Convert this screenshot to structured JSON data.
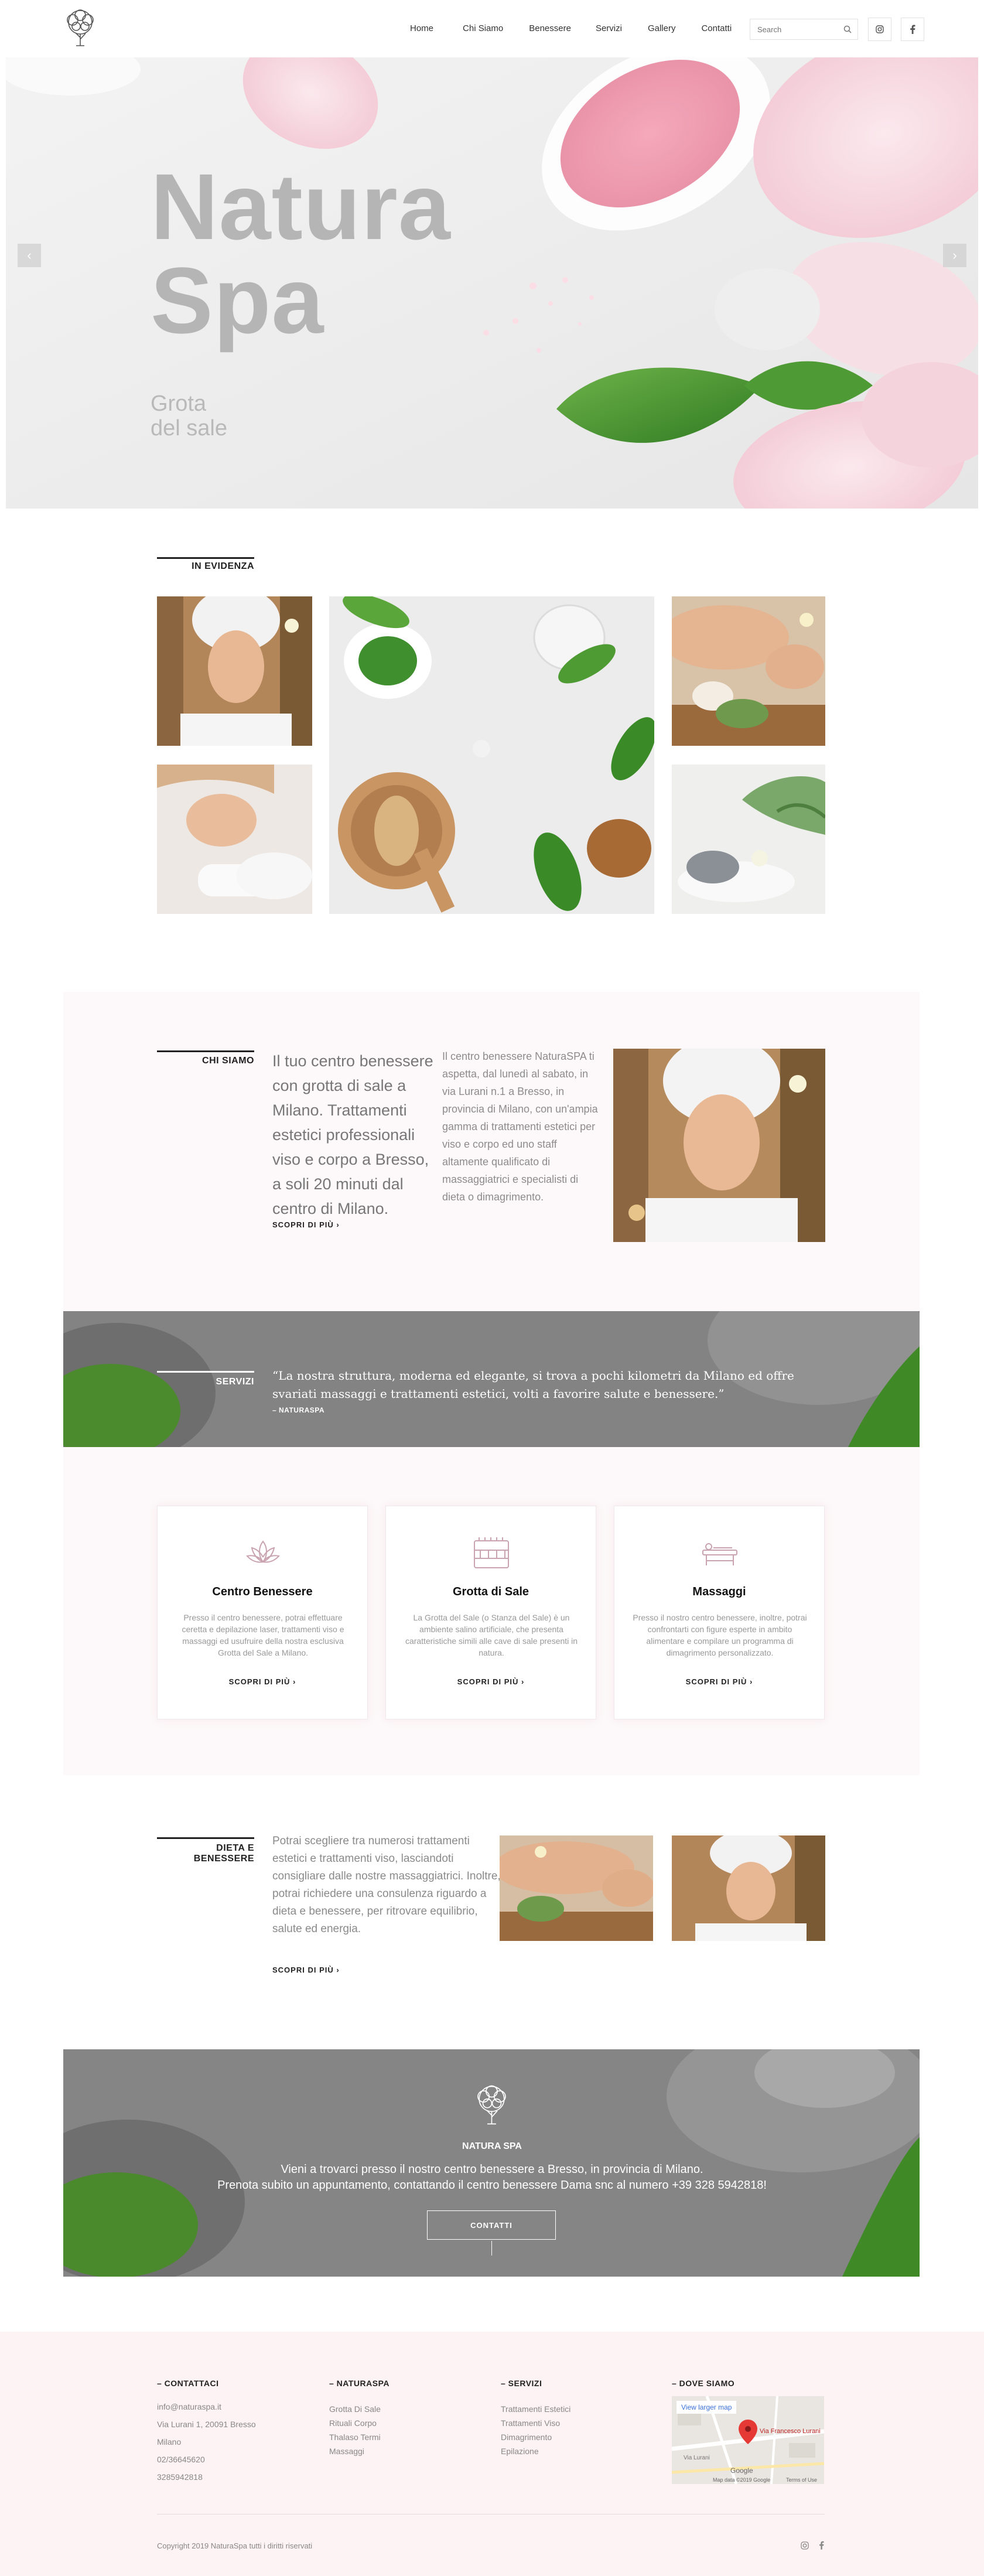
{
  "brand": {
    "name": "NATURA SPA"
  },
  "nav": {
    "items": [
      "Home",
      "Chi Siamo",
      "Benessere",
      "Servizi",
      "Gallery",
      "Contatti"
    ]
  },
  "search": {
    "placeholder": "Search"
  },
  "social": {
    "instagram": "instagram-icon",
    "facebook": "facebook-icon"
  },
  "hero": {
    "title_line1": "Natura",
    "title_line2": "Spa",
    "subtitle_line1": "Grota",
    "subtitle_line2": "del sale"
  },
  "evidenza": {
    "label": "IN EVIDENZA"
  },
  "chi_siamo": {
    "label": "CHI SIAMO",
    "lead": "Il tuo centro benessere con grotta di sale a Milano. Trattamenti estetici professionali viso e corpo a Bresso, a soli 20 minuti dal centro di Milano.",
    "body": "Il centro benessere NaturaSPA ti aspetta, dal lunedì al sabato, in via Lurani n.1 a Bresso, in provincia di Milano, con un'ampia gamma di trattamenti estetici per viso e corpo ed uno staff altamente qualificato di massaggiatrici e specialisti di dieta o dimagrimento.",
    "more": "SCOPRI DI PIÙ ›"
  },
  "servizi_band": {
    "label": "SERVIZI",
    "quote": "“La nostra struttura, moderna ed elegante, si trova a pochi kilometri da Milano ed offre svariati massaggi e trattamenti estetici, volti a favorire salute e benessere.”",
    "author": "– NATURASPA"
  },
  "cards": [
    {
      "icon": "lotus-icon",
      "title": "Centro Benessere",
      "text": "Presso il centro benessere, potrai effettuare ceretta e depilazione laser, trattamenti viso e massaggi ed usufruire della nostra esclusiva Grotta del Sale a Milano.",
      "more": "SCOPRI DI PIÙ ›"
    },
    {
      "icon": "salt-grotto-icon",
      "title": "Grotta di Sale",
      "text": "La Grotta del Sale (o Stanza del Sale) è un ambiente salino artificiale, che presenta caratteristiche simili alle cave di sale presenti in natura.",
      "more": "SCOPRI DI PIÙ ›"
    },
    {
      "icon": "massage-table-icon",
      "title": "Massaggi",
      "text": "Presso il nostro centro benessere, inoltre, potrai confrontarti con figure esperte in ambito alimentare e compilare un programma di dimagrimento personalizzato.",
      "more": "SCOPRI DI PIÙ ›"
    }
  ],
  "dieta": {
    "label": "DIETA E BENESSERE",
    "text": "Potrai scegliere tra numerosi trattamenti estetici e trattamenti viso, lasciandoti consigliare dalle nostre massaggiatrici. Inoltre, potrai richiedere una consulenza riguardo a dieta e benessere, per ritrovare equilibrio, salute ed energia.",
    "more": "SCOPRI DI PIÙ ›"
  },
  "cta": {
    "title": "NATURA SPA",
    "line1": "Vieni a trovarci presso il nostro centro benessere a Bresso, in provincia di Milano.",
    "line2": "Prenota subito un appuntamento, contattando il centro benessere Dama snc al numero +39 328 5942818!",
    "button": "CONTATTI"
  },
  "footer": {
    "contatti": {
      "title": "– CONTATTACI",
      "items": [
        "info@naturaspa.it",
        "Via Lurani 1, 20091 Bresso",
        "Milano",
        "02/36645620",
        "3285942818"
      ]
    },
    "naturaspa": {
      "title": "– NATURASPA",
      "items": [
        "Grotta Di Sale",
        "Rituali Corpo",
        "Thalaso Termi",
        "Massaggi"
      ]
    },
    "servizi": {
      "title": "– SERVIZI",
      "items": [
        "Trattamenti Estetici",
        "Trattamenti Viso",
        "Dimagrimento",
        "Epilazione"
      ]
    },
    "dove": {
      "title": "– DOVE SIAMO",
      "map_link": "View larger map",
      "map_pin": "Via Francesco Lurani",
      "map_street": "Via Lurani",
      "map_brand": "Google",
      "map_credits": "Map data ©2019 Google",
      "map_terms": "Terms of Use"
    },
    "copyright": "Copyright 2019 NaturaSpa tutti i diritti riservati"
  }
}
